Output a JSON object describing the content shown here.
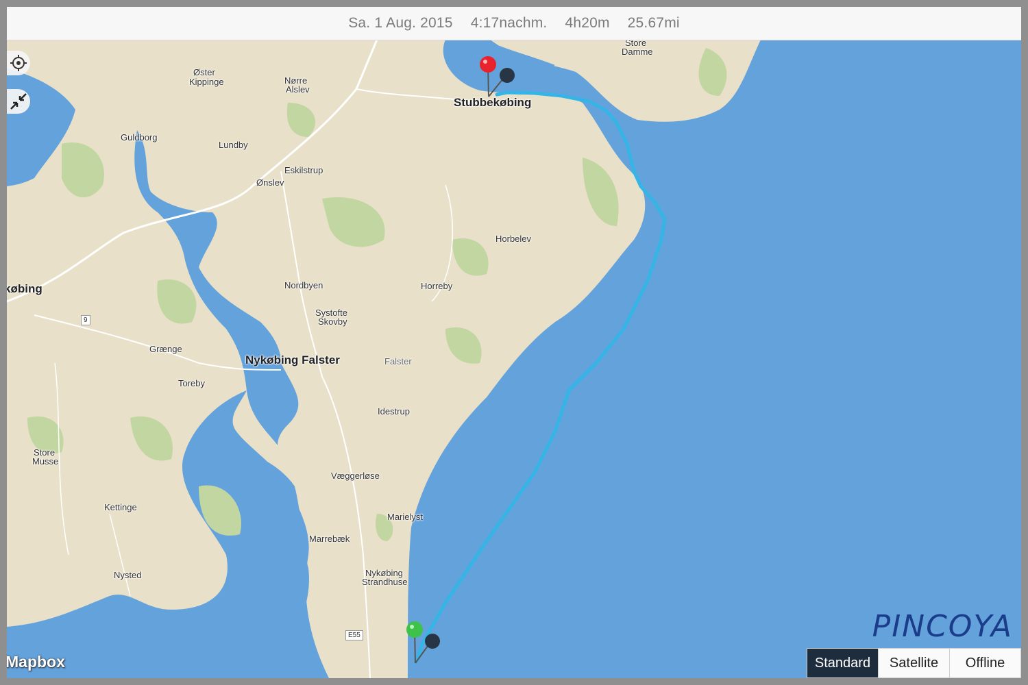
{
  "infobar": {
    "date": "Sa. 1 Aug. 2015",
    "time": "4:17nachm.",
    "duration": "4h20m",
    "distance": "25.67mi"
  },
  "controls": {
    "locate_icon": "crosshair-icon",
    "collapse_icon": "collapse-arrows-icon"
  },
  "places": {
    "stubbekobing": "Stubbekøbing",
    "nykobing_falster": "Nykøbing Falster",
    "kobing": "købing",
    "oster": "Øster",
    "kippinge": "Kippinge",
    "norre": "Nørre",
    "alslev": "Alslev",
    "store_damme_1": "Store",
    "store_damme_2": "Damme",
    "guldborg": "Guldborg",
    "lundby": "Lundby",
    "eskilstrup": "Eskilstrup",
    "onslev": "Ønslev",
    "horbelev": "Horbelev",
    "nordbyen": "Nordbyen",
    "horreby": "Horreby",
    "systofte": "Systofte",
    "skovby": "Skovby",
    "graenge": "Grænge",
    "toreby": "Toreby",
    "falster": "Falster",
    "idestrup": "Idestrup",
    "store_musse_1": "Store",
    "store_musse_2": "Musse",
    "vaeggerlose": "Væggerløse",
    "marielyst": "Marielyst",
    "kettinge": "Kettinge",
    "marrebaek": "Marrebæk",
    "nykobing_strandhuse_1": "Nykøbing",
    "nykobing_strandhuse_2": "Strandhuse",
    "nysted": "Nysted",
    "road_9": "9",
    "road_e55": "E55"
  },
  "attribution": "Mapbox",
  "brand": "PINCOYA",
  "map_modes": [
    "Standard",
    "Satellite",
    "Offline"
  ],
  "active_mode": "Standard",
  "colors": {
    "water": "#64a2dc",
    "land": "#e8e0c8",
    "forest": "#c1d6a0",
    "track": "#35b4e6",
    "start_pin": "#3fc24a",
    "end_pin": "#e8232e"
  }
}
